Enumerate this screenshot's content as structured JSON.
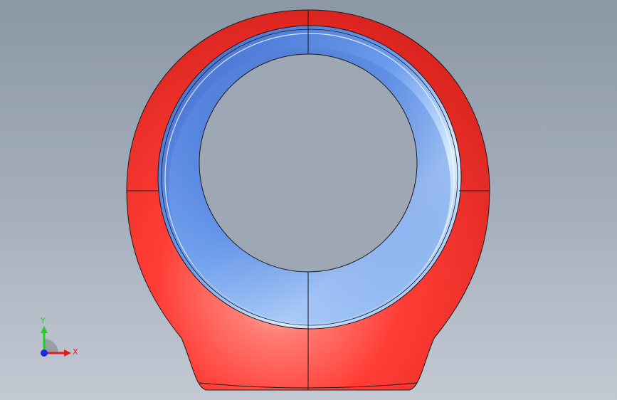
{
  "viewport": {
    "background_top": "#8c97a6",
    "background_bottom": "#c3c9d3"
  },
  "model": {
    "outer_body_color": "#ff3d36",
    "inner_bore_color": "#6a9cee",
    "edge_color": "#1a1a1a"
  },
  "triad": {
    "x_label": "X",
    "y_label": "Y",
    "x_color": "#e21c1c",
    "y_color": "#1ed11e",
    "z_color": "#1c2ce2"
  }
}
